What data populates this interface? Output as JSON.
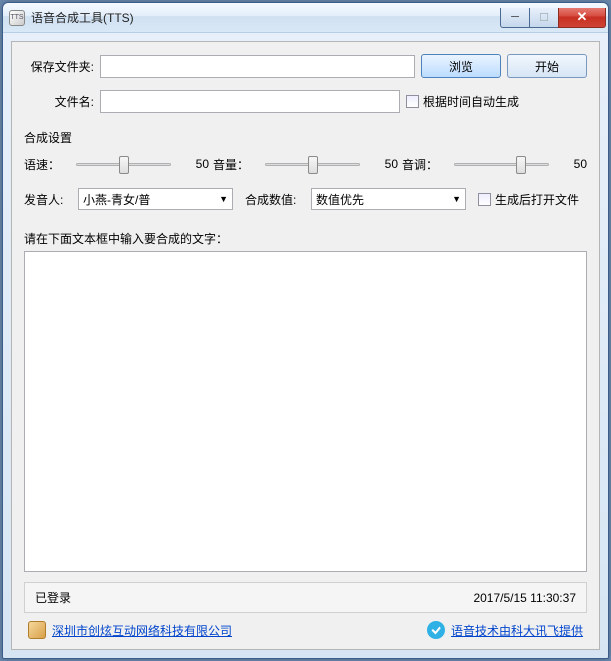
{
  "window": {
    "title": "语音合成工具(TTS)"
  },
  "toolbar": {
    "save_folder_label": "保存文件夹:",
    "filename_label": "文件名:",
    "browse_btn": "浏览",
    "start_btn": "开始",
    "auto_time_checkbox": "根据时间自动生成"
  },
  "settings": {
    "section_title": "合成设置",
    "speed_label": "语速：",
    "speed_value": "50",
    "volume_label": "音量：",
    "volume_value": "50",
    "pitch_label": "音调：",
    "pitch_value": "50",
    "speaker_label": "发音人:",
    "speaker_value": "小燕-青女/普",
    "quality_label": "合成数值:",
    "quality_value": "数值优先",
    "open_after_checkbox": "生成后打开文件"
  },
  "editor": {
    "prompt": "请在下面文本框中输入要合成的文字："
  },
  "status": {
    "login_state": "已登录",
    "timestamp": "2017/5/15 11:30:37"
  },
  "links": {
    "company": "深圳市创炫互动网络科技有限公司",
    "provider": "语音技术由科大讯飞提供"
  }
}
